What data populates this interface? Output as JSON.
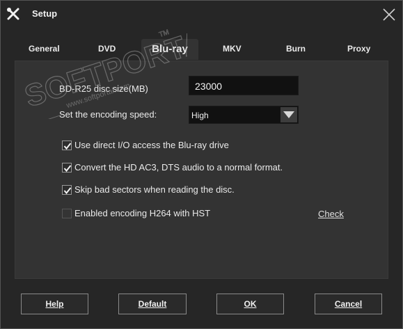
{
  "window": {
    "title": "Setup",
    "icons": {
      "app": "tools-icon",
      "close": "close-icon"
    }
  },
  "tabs": [
    {
      "label": "General",
      "active": false
    },
    {
      "label": "DVD",
      "active": false
    },
    {
      "label": "Blu-ray",
      "active": true
    },
    {
      "label": "MKV",
      "active": false
    },
    {
      "label": "Burn",
      "active": false
    },
    {
      "label": "Proxy",
      "active": false
    }
  ],
  "bluray": {
    "disc_size_label": "BD-R25 disc size(MB)",
    "disc_size_value": "23000",
    "speed_label": "Set the encoding speed:",
    "speed_value": "High",
    "options": [
      {
        "label": "Use direct I/O access the Blu-ray drive",
        "checked": true
      },
      {
        "label": "Convert the HD AC3, DTS audio to a normal format.",
        "checked": true
      },
      {
        "label": "Skip bad sectors when reading the disc.",
        "checked": true
      },
      {
        "label": "Enabled encoding H264 with HST",
        "checked": false
      }
    ],
    "check_link": "Check"
  },
  "buttons": {
    "help": "Help",
    "default": "Default",
    "ok": "OK",
    "cancel": "Cancel"
  },
  "watermark": {
    "brand": "SOFTPORTAL",
    "tm": "TM",
    "url": "www.softportal.com"
  },
  "colors": {
    "background": "#262626",
    "panel": "#333333",
    "field": "#111111",
    "text": "#eaeaea"
  }
}
